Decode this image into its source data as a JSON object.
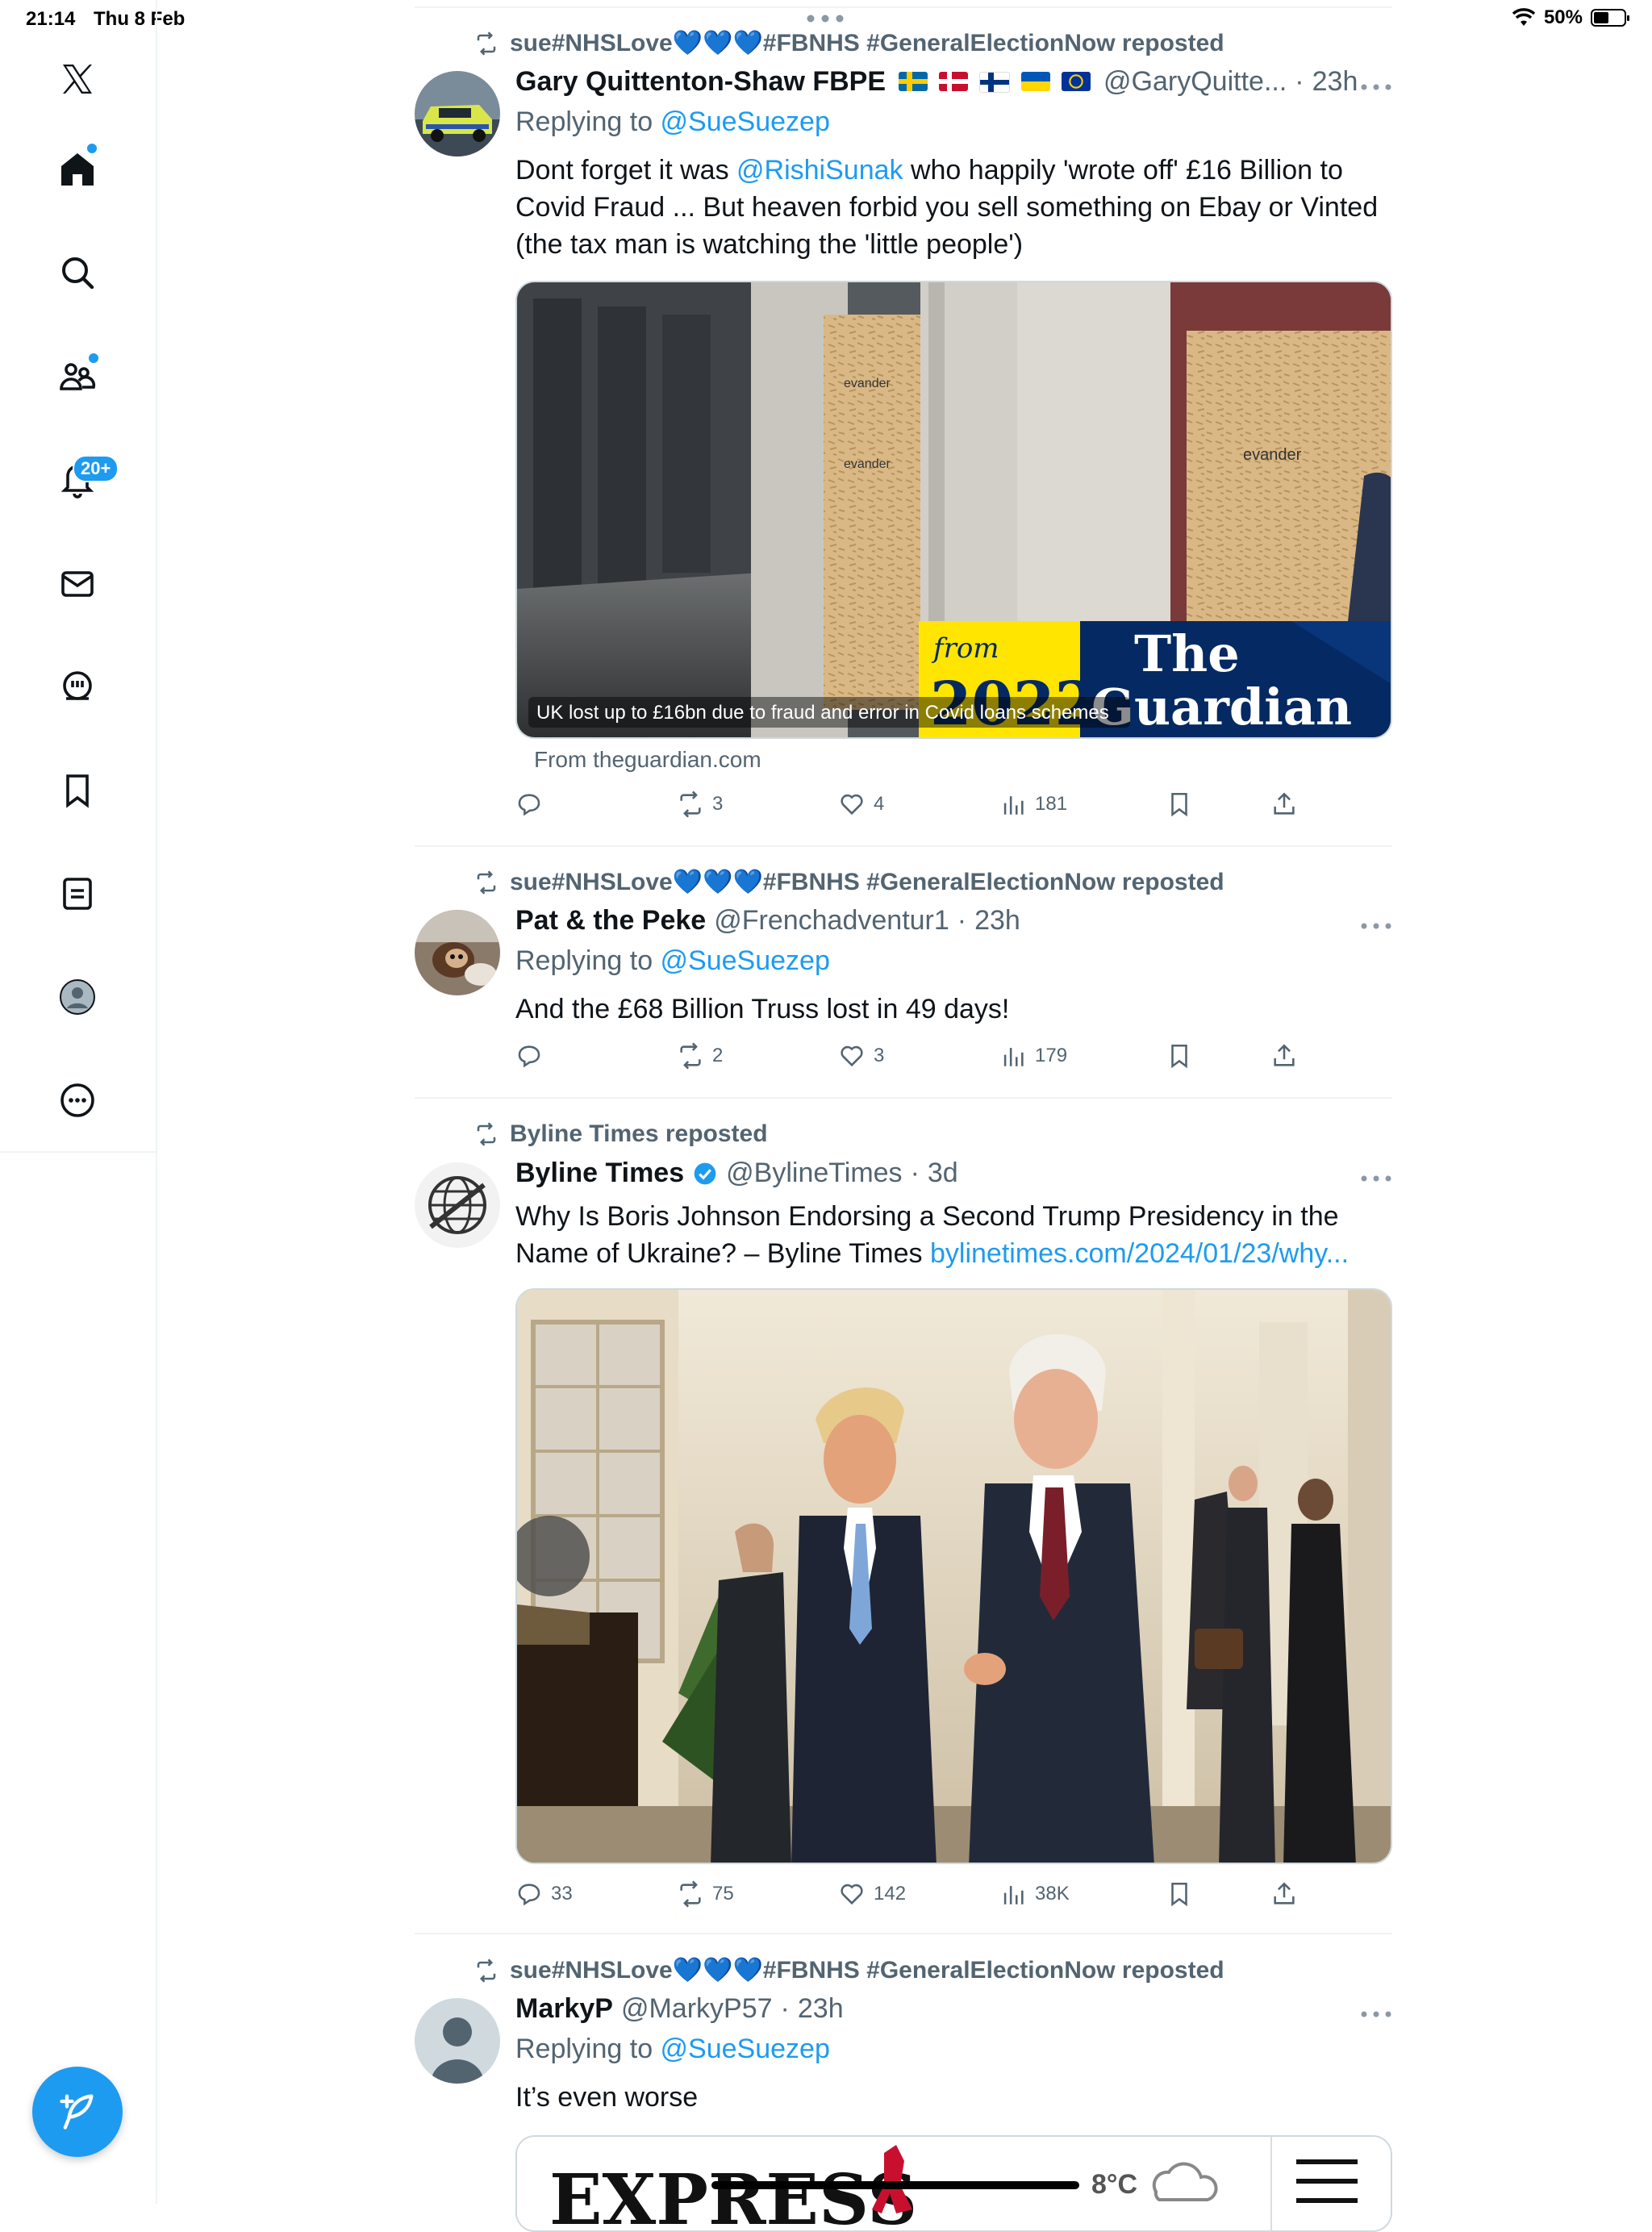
{
  "status_bar": {
    "time": "21:14",
    "date": "Thu 8 Feb",
    "battery": "50%"
  },
  "sidebar": {
    "items": [
      "x-logo",
      "home",
      "explore",
      "communities",
      "notifications",
      "messages",
      "grok",
      "bookmarks",
      "lists",
      "profile",
      "more"
    ],
    "notifications_badge": "20+"
  },
  "tweets": [
    {
      "reposted_by": "sue#NHSLove💙💙💙#FBNHS #GeneralElectionNow reposted",
      "name": "Gary Quittenton-Shaw FBPE",
      "handle": "@GaryQuitte...",
      "time": "23h",
      "reply_prefix": "Replying to ",
      "reply_to": "@SueSuezep",
      "text_pre": "Dont forget it was ",
      "mention": "@RishiSunak",
      "text_post": " who happily 'wrote off' £16 Billion to Covid Fraud ... But heaven forbid you sell something on Ebay or Vinted (the tax man is watching the 'little people')",
      "card": {
        "caption": "UK lost up to £16bn due to fraud and error in Covid loans schemes",
        "from_label": "from",
        "year": "2022",
        "publisher_line1": "The",
        "publisher_line2": "Guardian",
        "source": "From theguardian.com",
        "board_text": "evander"
      },
      "stats": {
        "replies": "",
        "reposts": "3",
        "likes": "4",
        "views": "181"
      }
    },
    {
      "reposted_by": "sue#NHSLove💙💙💙#FBNHS #GeneralElectionNow reposted",
      "name": "Pat & the Peke",
      "handle": "@Frenchadventur1",
      "time": "23h",
      "reply_prefix": "Replying to ",
      "reply_to": "@SueSuezep",
      "text": "And the £68 Billion Truss lost in 49 days!",
      "stats": {
        "replies": "",
        "reposts": "2",
        "likes": "3",
        "views": "179"
      }
    },
    {
      "reposted_by": "Byline Times reposted",
      "name": "Byline Times",
      "handle": "@BylineTimes",
      "time": "3d",
      "text": "Why Is Boris Johnson Endorsing a Second Trump Presidency in the Name of Ukraine? – Byline Times ",
      "link": "bylinetimes.com/2024/01/23/why...",
      "stats": {
        "replies": "33",
        "reposts": "75",
        "likes": "142",
        "views": "38K"
      }
    },
    {
      "reposted_by": "sue#NHSLove💙💙💙#FBNHS #GeneralElectionNow reposted",
      "name": "MarkyP",
      "handle": "@MarkyP57",
      "time": "23h",
      "reply_prefix": "Replying to ",
      "reply_to": "@SueSuezep",
      "text": "It’s even worse",
      "card": {
        "masthead": "EXPRESS",
        "weather": "8°C"
      }
    }
  ],
  "colors": {
    "accent": "#1d9bf0",
    "text": "#0f1419",
    "muted": "#536471",
    "border": "#eff3f4"
  }
}
